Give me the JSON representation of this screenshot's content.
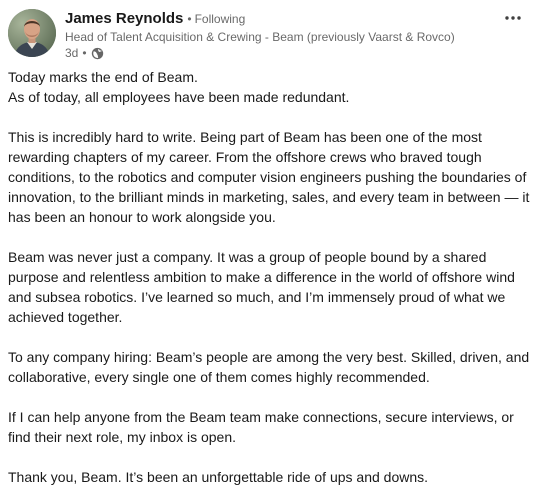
{
  "author": {
    "name": "James Reynolds",
    "follow_status": "Following",
    "headline": "Head of Talent Acquisition & Crewing - Beam (previously Vaarst & Rovco)",
    "time_ago": "3d",
    "visibility_icon": "globe-icon",
    "avatar_icon": "profile-photo"
  },
  "menu": {
    "icon": "more-options-icon"
  },
  "post": {
    "paragraphs": [
      {
        "line1": "Today marks the end of Beam.",
        "line2": "As of today, all employees have been made redundant."
      },
      "This is incredibly hard to write. Being part of Beam has been one of the most rewarding chapters of my career. From the offshore crews who braved tough conditions, to the robotics and computer vision engineers pushing the boundaries of innovation, to the brilliant minds in marketing, sales, and every team in between — it has been an honour to work alongside you.",
      "Beam was never just a company. It was a group of people bound by a shared purpose and relentless ambition to make a difference in the world of offshore wind and subsea robotics. I’ve learned so much, and I’m immensely proud of what we achieved together.",
      "To any company hiring: Beam’s people are among the very best. Skilled, driven, and collaborative, every single one of them comes highly recommended.",
      "If I can help anyone from the Beam team make connections, secure interviews, or find their next role, my inbox is open.",
      "Thank you, Beam. It’s been an unforgettable ride of ups and downs."
    ]
  },
  "colors": {
    "text_primary": "#191919",
    "text_secondary": "#666666",
    "background": "#ffffff"
  }
}
